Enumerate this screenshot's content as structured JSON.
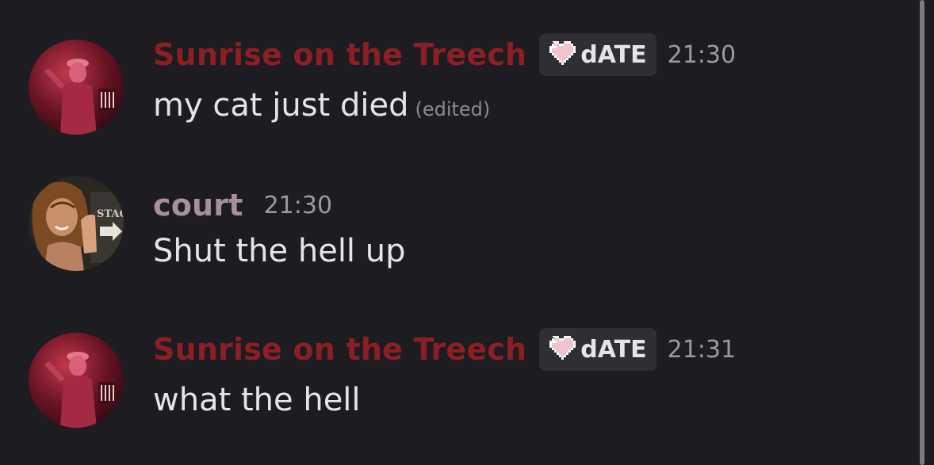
{
  "messages": [
    {
      "author": "Sunrise on the Treech",
      "author_color": "#8b1f25",
      "tag": {
        "icon": "pink-pixel-heart-icon",
        "label": "dATE"
      },
      "timestamp": "21:30",
      "text": "my cat just died",
      "edited_label": "(edited)"
    },
    {
      "author": "court",
      "author_color": "#a8909b",
      "timestamp": "21:30",
      "text": "Shut the hell up"
    },
    {
      "author": "Sunrise on the Treech",
      "author_color": "#8b1f25",
      "tag": {
        "icon": "pink-pixel-heart-icon",
        "label": "dATE"
      },
      "timestamp": "21:31",
      "text": "what the hell"
    }
  ],
  "colors": {
    "background": "#1c1c21",
    "tag_background": "#2e2e35",
    "message_text": "#e4e4ea",
    "timestamp": "#9a9aa4",
    "heart": "#f3c2cf"
  }
}
